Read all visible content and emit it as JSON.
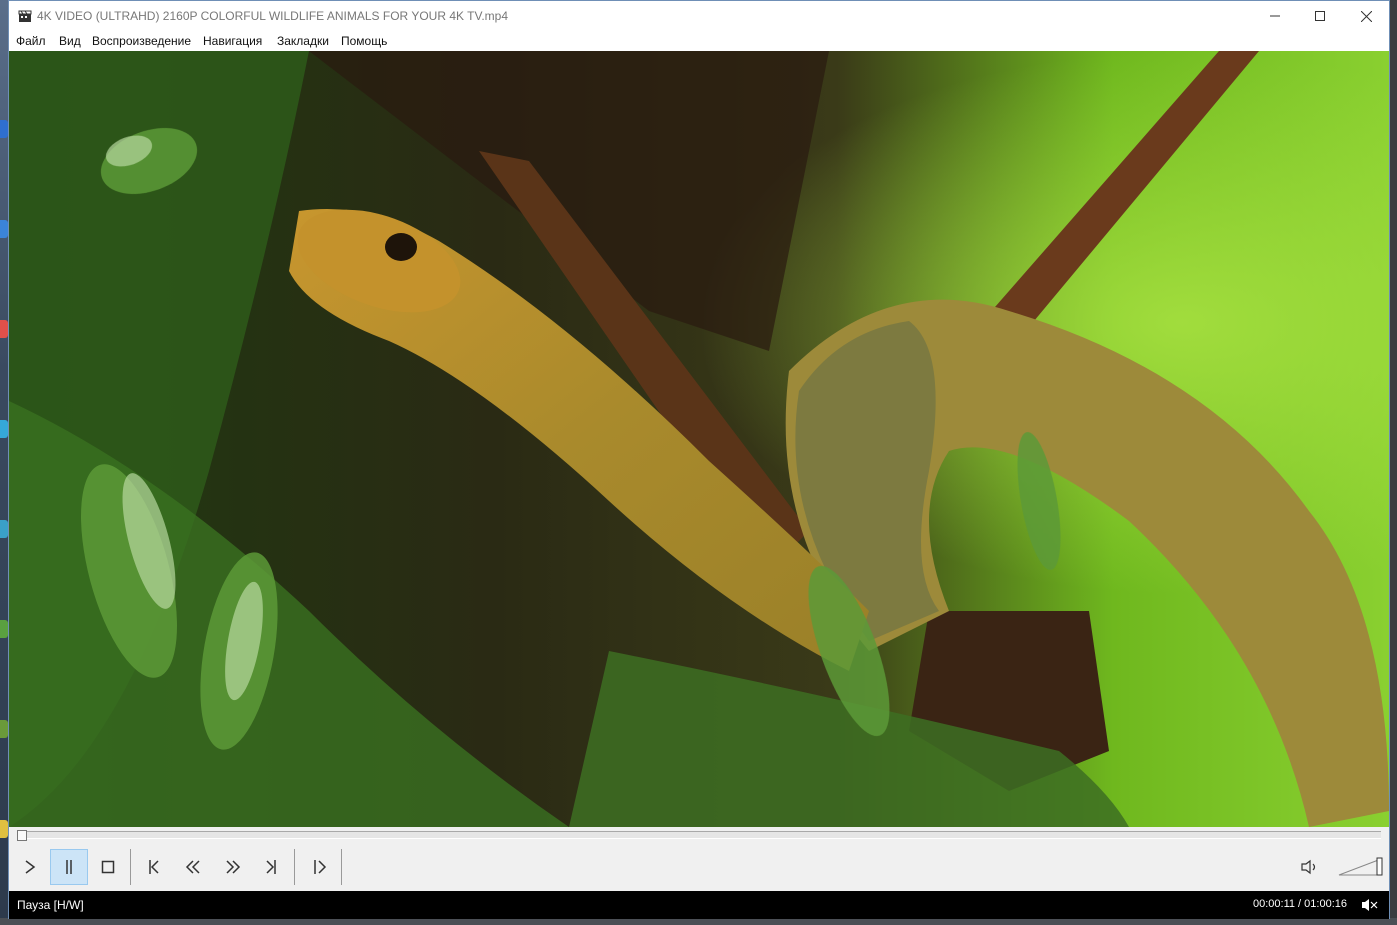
{
  "window": {
    "title": "4K VIDEO (ULTRAHD) 2160P COLORFUL WILDLIFE ANIMALS FOR YOUR 4K TV.mp4",
    "minimize_icon": "minimize-icon",
    "maximize_icon": "maximize-icon",
    "close_icon": "close-icon"
  },
  "menu": {
    "items": [
      "Файл",
      "Вид",
      "Воспроизведение",
      "Навигация",
      "Закладки",
      "Помощь"
    ]
  },
  "video": {
    "description_icon": "video-frame"
  },
  "seek": {
    "position_fraction": 0.0015
  },
  "controls": {
    "buttons": [
      {
        "name": "play-button",
        "icon": "play-icon"
      },
      {
        "name": "pause-button",
        "icon": "pause-icon",
        "active": true
      },
      {
        "name": "stop-button",
        "icon": "stop-icon"
      },
      {
        "name": "previous-button",
        "icon": "skip-back-icon"
      },
      {
        "name": "rewind-button",
        "icon": "rewind-icon"
      },
      {
        "name": "fast-forward-button",
        "icon": "fast-forward-icon"
      },
      {
        "name": "next-button",
        "icon": "skip-forward-icon"
      },
      {
        "name": "frame-step-button",
        "icon": "frame-step-icon"
      }
    ],
    "volume_icon": "speaker-icon",
    "volume_level": 1.0
  },
  "status": {
    "state": "Пауза [H/W]",
    "time": "00:00:11 / 01:00:16",
    "status_icon": "mute-status-icon"
  },
  "colors": {
    "titlebar_bg": "#ffffff",
    "controls_bg": "#f0f0f0",
    "status_bg": "#000000",
    "active_button_bg": "#cce4f7"
  }
}
